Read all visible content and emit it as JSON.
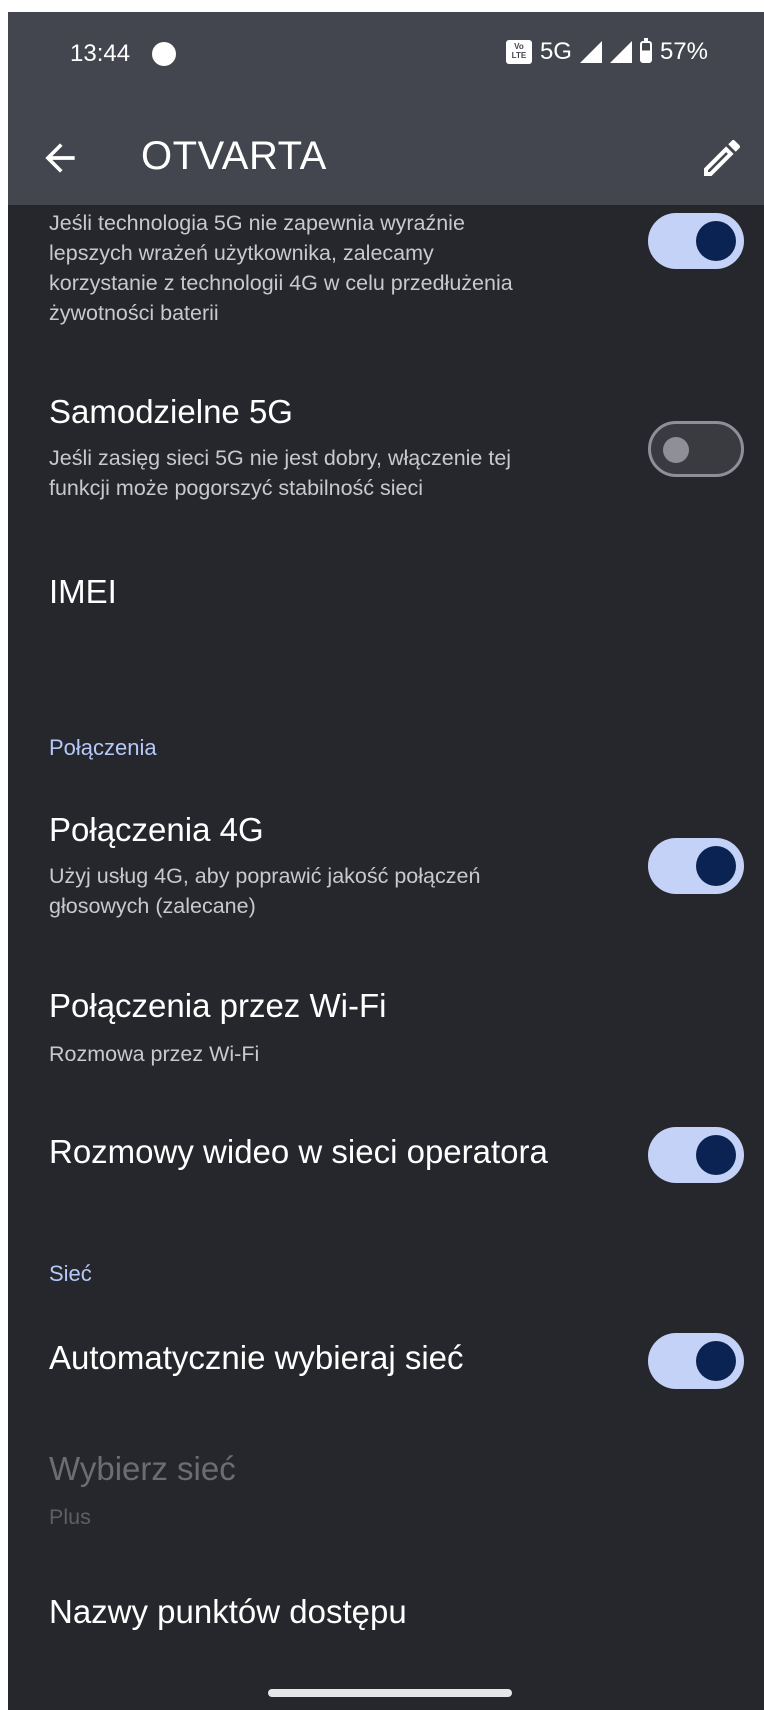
{
  "status_bar": {
    "time": "13:44",
    "network": "5G",
    "battery": "57%",
    "volte_text": "Vo LTE"
  },
  "header": {
    "title": "OTVARTA"
  },
  "items": {
    "prefer_4g": {
      "subtitle": "Jeśli technologia 5G nie zapewnia wyraźnie\nlepszych wrażeń użytkownika, zalecamy\nkorzystanie z technologii 4G w celu przedłużenia\nżywotności baterii",
      "toggle": "on"
    },
    "sa_5g": {
      "title": "Samodzielne 5G",
      "subtitle": "Jeśli zasięg sieci 5G nie jest dobry, włączenie tej\nfunkcji może pogorszyć stabilność sieci",
      "toggle": "off"
    },
    "imei": {
      "title": "IMEI"
    },
    "calls_section": "Połączenia",
    "volte": {
      "title": "Połączenia 4G",
      "subtitle": "Użyj usług 4G, aby poprawić jakość połączeń\ngłosowych (zalecane)",
      "toggle": "on"
    },
    "wifi_calling": {
      "title": "Połączenia przez Wi-Fi",
      "subtitle": "Rozmowa przez Wi-Fi"
    },
    "video_calls": {
      "title": "Rozmowy wideo w sieci operatora",
      "toggle": "on"
    },
    "network_section": "Sieć",
    "auto_network": {
      "title": "Automatycznie wybieraj sieć",
      "toggle": "on"
    },
    "choose_network": {
      "title": "Wybierz sieć",
      "subtitle": "Plus"
    },
    "apn": {
      "title": "Nazwy punktów dostępu"
    }
  },
  "colors": {
    "background": "#26272c",
    "header": "#44464f",
    "accent": "#b5c8f8",
    "toggle_on_track": "#c5d2f7",
    "toggle_on_knob": "#0b2352"
  }
}
